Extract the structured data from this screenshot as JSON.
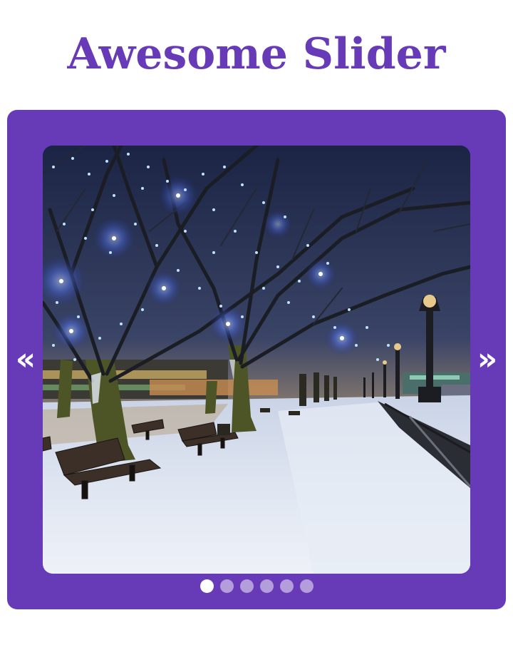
{
  "title": "Awesome Slider",
  "colors": {
    "title": "#673ab7",
    "frame": "#673ab7",
    "dot_active": "#ffffff",
    "dot_inactive": "#b39ddb",
    "arrow": "#ffffff"
  },
  "nav": {
    "prev_icon": "«",
    "next_icon": "»",
    "prev_icon_name": "double-chevron-left-icon",
    "next_icon_name": "double-chevron-right-icon"
  },
  "slider": {
    "active_index": 0,
    "slide_count": 6,
    "current_image": "Snowy riverside promenade at night with benches, lamp posts and trees wrapped in blue lights"
  }
}
